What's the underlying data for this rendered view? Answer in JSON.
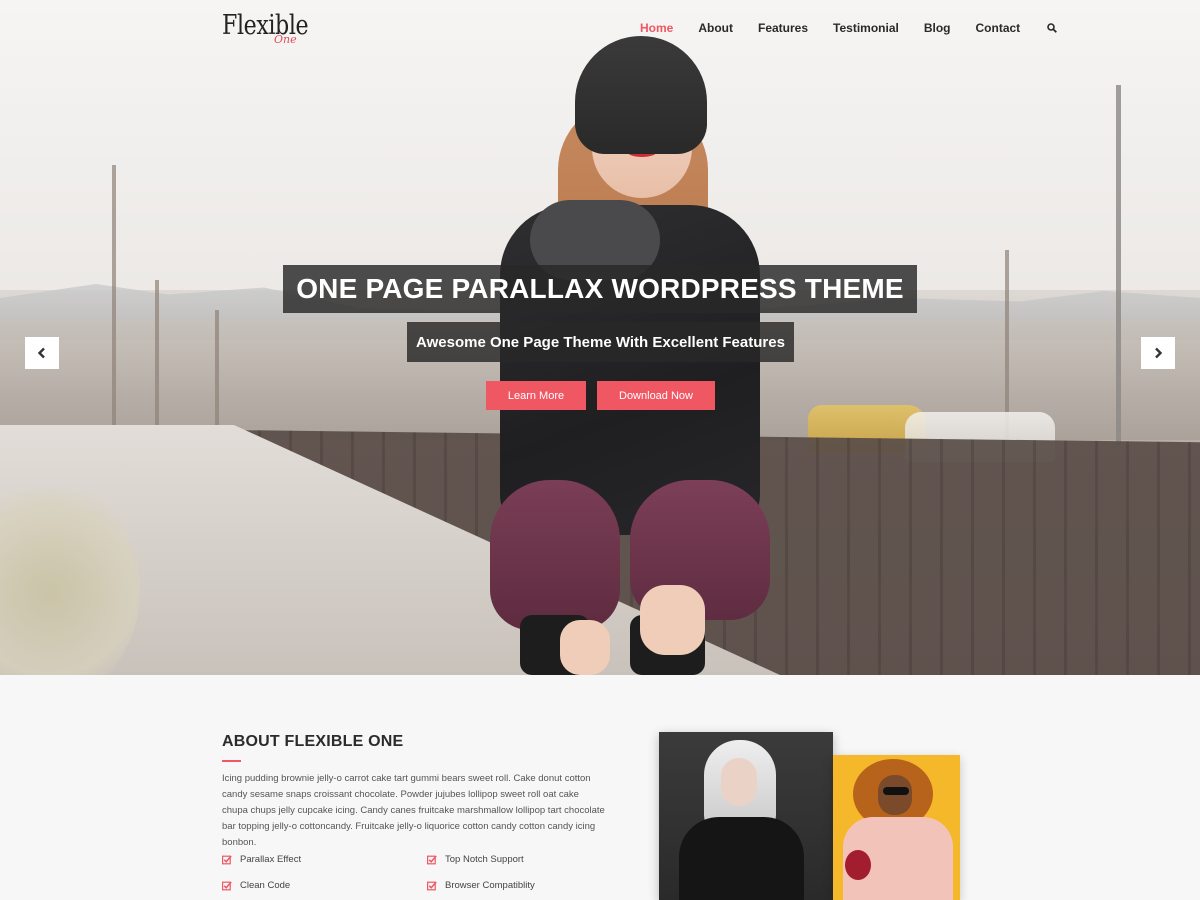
{
  "brand": {
    "logo_text": "Flexible",
    "logo_script": "One"
  },
  "nav": {
    "items": [
      {
        "label": "Home",
        "active": true
      },
      {
        "label": "About"
      },
      {
        "label": "Features"
      },
      {
        "label": "Testimonial"
      },
      {
        "label": "Blog"
      },
      {
        "label": "Contact"
      }
    ],
    "search_icon": "search-icon"
  },
  "slider": {
    "title": "ONE PAGE PARALLAX WORDPRESS THEME",
    "subtitle": "Awesome One Page Theme With Excellent Features",
    "buttons": {
      "learn_more": "Learn More",
      "download_now": "Download Now"
    },
    "prev_icon": "chevron-left-icon",
    "next_icon": "chevron-right-icon"
  },
  "about": {
    "title": "ABOUT FLEXIBLE ONE",
    "text": "Icing pudding brownie jelly-o carrot cake tart gummi bears sweet roll. Cake donut cotton candy sesame snaps croissant chocolate. Powder jujubes lollipop sweet roll oat cake chupa chups jelly cupcake icing. Candy canes fruitcake marshmallow lollipop tart chocolate bar topping jelly-o cottoncandy. Fruitcake jelly-o liquorice cotton candy cotton candy icing bonbon.",
    "features": [
      "Parallax Effect",
      "Top Notch Support",
      "Clean Code",
      "Browser Compatiblity"
    ]
  },
  "colors": {
    "accent": "#ef5763",
    "overlay": "#282828",
    "text_dark": "#2b2b2b"
  }
}
